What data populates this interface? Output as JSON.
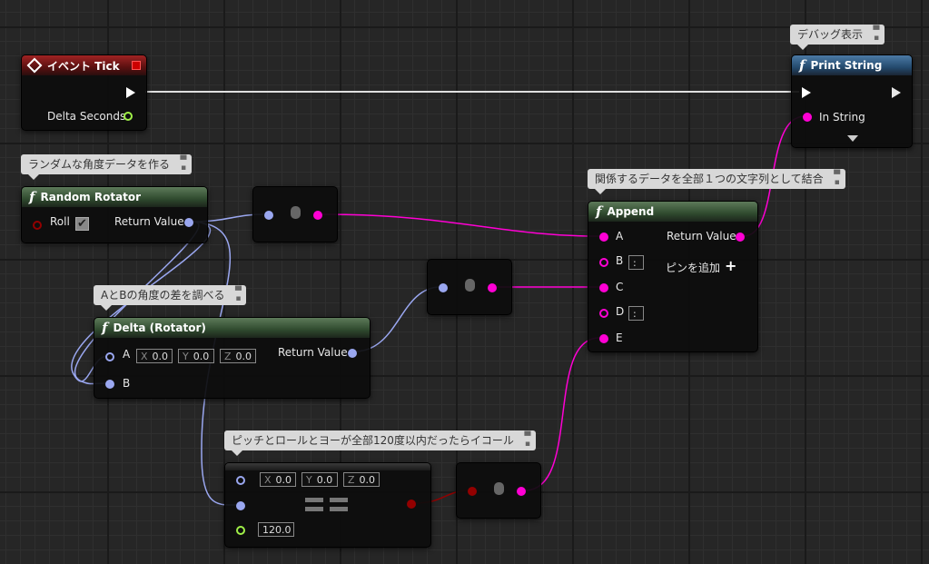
{
  "comments": {
    "debug_display": "デバッグ表示",
    "random_rot": "ランダムな角度データを作る",
    "append_all": "関係するデータを全部１つの文字列として結合",
    "delta_diff": "AとBの角度の差を調べる",
    "pitch_roll_yaw": "ピッチとロールとヨーが全部120度以内だったらイコール"
  },
  "event_tick": {
    "title": "イベント Tick",
    "delta_seconds": "Delta Seconds"
  },
  "print_string": {
    "title": "Print String",
    "in_string": "In String"
  },
  "random_rotator": {
    "title": "Random Rotator",
    "roll": "Roll",
    "return_value": "Return Value"
  },
  "append": {
    "title": "Append",
    "a": "A",
    "b": "B",
    "c": "C",
    "d": "D",
    "e": "E",
    "b_value": ":",
    "d_value": ":",
    "return_value": "Return Value",
    "add_pin": "ピンを追加"
  },
  "delta_rotator": {
    "title": "Delta (Rotator)",
    "a": "A",
    "b": "B",
    "return_value": "Return Value",
    "x_label": "X",
    "y_label": "Y",
    "z_label": "Z",
    "x": "0.0",
    "y": "0.0",
    "z": "0.0"
  },
  "equal_node": {
    "x_label": "X",
    "y_label": "Y",
    "z_label": "Z",
    "x": "0.0",
    "y": "0.0",
    "z": "0.0",
    "tolerance": "120.0"
  },
  "colors": {
    "string_pin": "#ff00d4",
    "rotator_pin": "#9aa7f0",
    "float_pin": "#a0f048",
    "bool_pin": "#930000",
    "exec_pin": "#ffffff"
  }
}
